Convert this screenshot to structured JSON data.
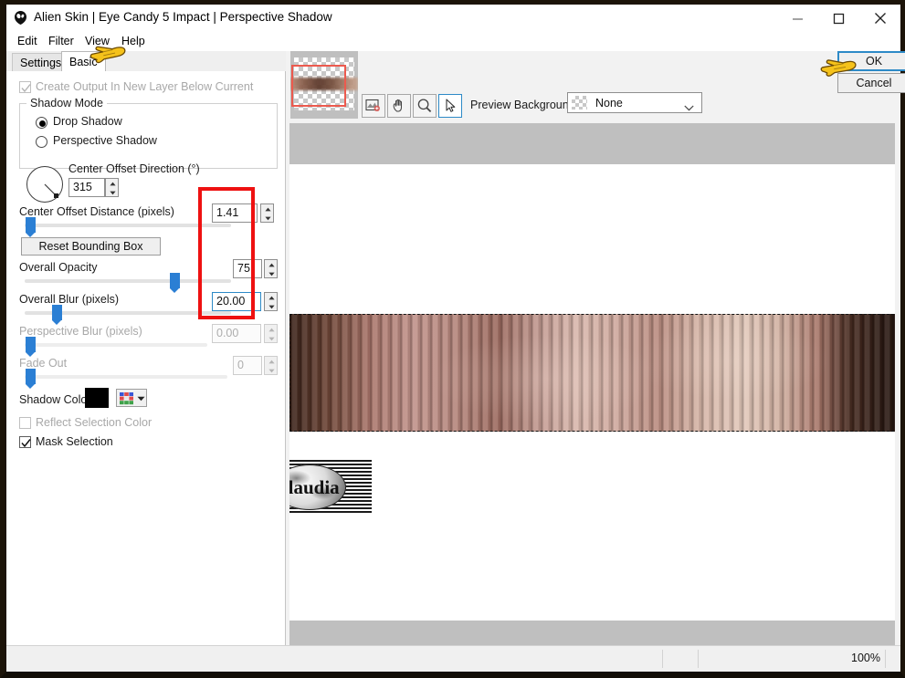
{
  "window": {
    "title": "Alien Skin | Eye Candy 5 Impact | Perspective Shadow",
    "app_icon": "alien-skin-icon",
    "minimize": "–",
    "maximize": "□",
    "close": "×"
  },
  "menu": {
    "items": [
      {
        "label": "Edit"
      },
      {
        "label": "Filter"
      },
      {
        "label": "View"
      },
      {
        "label": "Help"
      }
    ]
  },
  "tabs": {
    "items": [
      {
        "label": "Settings",
        "active": false
      },
      {
        "label": "Basic",
        "active": true
      }
    ]
  },
  "settings": {
    "create_output": {
      "label": "Create Output In New Layer Below Current",
      "checked": true,
      "enabled": false
    },
    "shadow_mode": {
      "title": "Shadow Mode",
      "options": [
        {
          "label": "Drop Shadow",
          "selected": true
        },
        {
          "label": "Perspective Shadow",
          "selected": false
        }
      ]
    },
    "center_offset_direction": {
      "label": "Center Offset Direction (°)",
      "value": "315",
      "dial_name": "direction-dial"
    },
    "center_offset_distance": {
      "label": "Center Offset Distance (pixels)",
      "value": "1.41",
      "slider_pct": 2
    },
    "reset_bounding_box": {
      "label": "Reset Bounding Box"
    },
    "overall_opacity": {
      "label": "Overall Opacity",
      "value": "75",
      "slider_pct": 73
    },
    "overall_blur": {
      "label": "Overall Blur (pixels)",
      "value": "20.00",
      "slider_pct": 18,
      "focused": true
    },
    "perspective_blur": {
      "label": "Perspective Blur (pixels)",
      "value": "0.00",
      "slider_pct": 2,
      "enabled": false
    },
    "fade_out": {
      "label": "Fade Out",
      "value": "0",
      "slider_pct": 2,
      "enabled": false
    },
    "shadow_color": {
      "label": "Shadow Color",
      "color": "#000000",
      "palette_icon": "color-grid-icon"
    },
    "reflect_selection_color": {
      "label": "Reflect Selection Color",
      "checked": false,
      "enabled": false
    },
    "mask_selection": {
      "label": "Mask Selection",
      "checked": true,
      "enabled": true
    }
  },
  "toolbar": {
    "tools": [
      {
        "name": "navigator-icon",
        "selected": false
      },
      {
        "name": "hand-icon",
        "selected": false
      },
      {
        "name": "zoom-icon",
        "selected": false
      },
      {
        "name": "arrow-select-icon",
        "selected": true
      }
    ],
    "preview_background": {
      "label": "Preview Background:",
      "value": "None",
      "options": [
        "None"
      ]
    }
  },
  "dialog": {
    "ok_label": "OK",
    "cancel_label": "Cancel"
  },
  "statusbar": {
    "zoom": "100%"
  },
  "annotations": {
    "red_box_name": "red-highlight-box",
    "hand_pointer_tab": "hand-pointer-basic-tab",
    "hand_pointer_ok": "hand-pointer-ok-button"
  },
  "preview": {
    "banner_name": "striped-banner-image",
    "watermark": "claudia",
    "thumbnail_name": "navigator-thumbnail"
  },
  "colors": {
    "accent": "#2b7fd4",
    "annotation_red": "#ee1111",
    "canvas_grey": "#bfbfbf",
    "shadow": "#000000"
  }
}
